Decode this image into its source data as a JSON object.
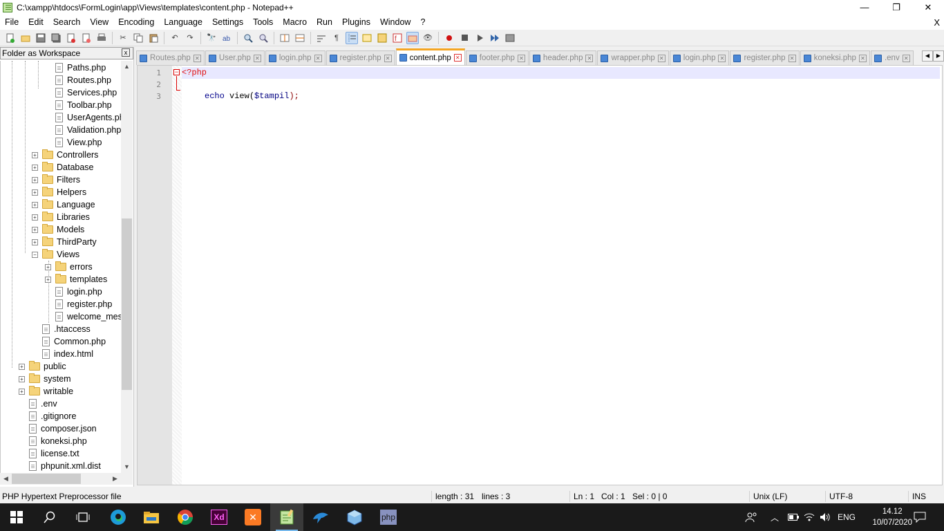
{
  "window": {
    "title": "C:\\xampp\\htdocs\\FormLogin\\app\\Views\\templates\\content.php - Notepad++",
    "minimize": "—",
    "maximize": "❐",
    "close": "✕"
  },
  "menu": [
    "File",
    "Edit",
    "Search",
    "View",
    "Encoding",
    "Language",
    "Settings",
    "Tools",
    "Macro",
    "Run",
    "Plugins",
    "Window",
    "?"
  ],
  "menu_close": "X",
  "sidebar": {
    "title": "Folder as Workspace",
    "close": "x",
    "items": [
      {
        "label": "Paths.php",
        "kind": "file"
      },
      {
        "label": "Routes.php",
        "kind": "file"
      },
      {
        "label": "Services.php",
        "kind": "file"
      },
      {
        "label": "Toolbar.php",
        "kind": "file"
      },
      {
        "label": "UserAgents.php",
        "kind": "file"
      },
      {
        "label": "Validation.php",
        "kind": "file"
      },
      {
        "label": "View.php",
        "kind": "file"
      },
      {
        "label": "Controllers",
        "kind": "folder"
      },
      {
        "label": "Database",
        "kind": "folder"
      },
      {
        "label": "Filters",
        "kind": "folder"
      },
      {
        "label": "Helpers",
        "kind": "folder"
      },
      {
        "label": "Language",
        "kind": "folder"
      },
      {
        "label": "Libraries",
        "kind": "folder"
      },
      {
        "label": "Models",
        "kind": "folder"
      },
      {
        "label": "ThirdParty",
        "kind": "folder"
      },
      {
        "label": "Views",
        "kind": "folder-open"
      },
      {
        "label": "errors",
        "kind": "folder"
      },
      {
        "label": "templates",
        "kind": "folder"
      },
      {
        "label": "login.php",
        "kind": "file"
      },
      {
        "label": "register.php",
        "kind": "file"
      },
      {
        "label": "welcome_message.php",
        "kind": "file"
      },
      {
        "label": ".htaccess",
        "kind": "file"
      },
      {
        "label": "Common.php",
        "kind": "file"
      },
      {
        "label": "index.html",
        "kind": "file"
      },
      {
        "label": "public",
        "kind": "folder"
      },
      {
        "label": "system",
        "kind": "folder"
      },
      {
        "label": "writable",
        "kind": "folder"
      },
      {
        "label": ".env",
        "kind": "file"
      },
      {
        "label": ".gitignore",
        "kind": "file"
      },
      {
        "label": "composer.json",
        "kind": "file"
      },
      {
        "label": "koneksi.php",
        "kind": "file"
      },
      {
        "label": "license.txt",
        "kind": "file"
      },
      {
        "label": "phpunit.xml.dist",
        "kind": "file"
      }
    ]
  },
  "tabs": [
    {
      "label": "Routes.php"
    },
    {
      "label": "User.php"
    },
    {
      "label": "login.php"
    },
    {
      "label": "register.php"
    },
    {
      "label": "content.php",
      "active": true
    },
    {
      "label": "footer.php"
    },
    {
      "label": "header.php"
    },
    {
      "label": "wrapper.php"
    },
    {
      "label": "login.php"
    },
    {
      "label": "register.php"
    },
    {
      "label": "koneksi.php"
    },
    {
      "label": ".env"
    }
  ],
  "editor": {
    "line_numbers": [
      "1",
      "2",
      "3"
    ],
    "line1": "<?php",
    "line3_keyword": "echo",
    "line3_fn": " view(",
    "line3_var": "$tampil",
    "line3_end": ");"
  },
  "status": {
    "filetype": "PHP Hypertext Preprocessor file",
    "length": "length : 31",
    "lines": "lines : 3",
    "ln": "Ln : 1",
    "col": "Col : 1",
    "sel": "Sel : 0 | 0",
    "eol": "Unix (LF)",
    "encoding": "UTF-8",
    "mode": "INS"
  },
  "taskbar": {
    "lang": "ENG",
    "time": "14.12",
    "date": "10/07/2020",
    "xd_label": "Xd",
    "php_label": "php"
  },
  "colors": {
    "accent_tab": "#f5a623",
    "taskbar": "#1a1a1a",
    "php_tag": "#e01010"
  }
}
